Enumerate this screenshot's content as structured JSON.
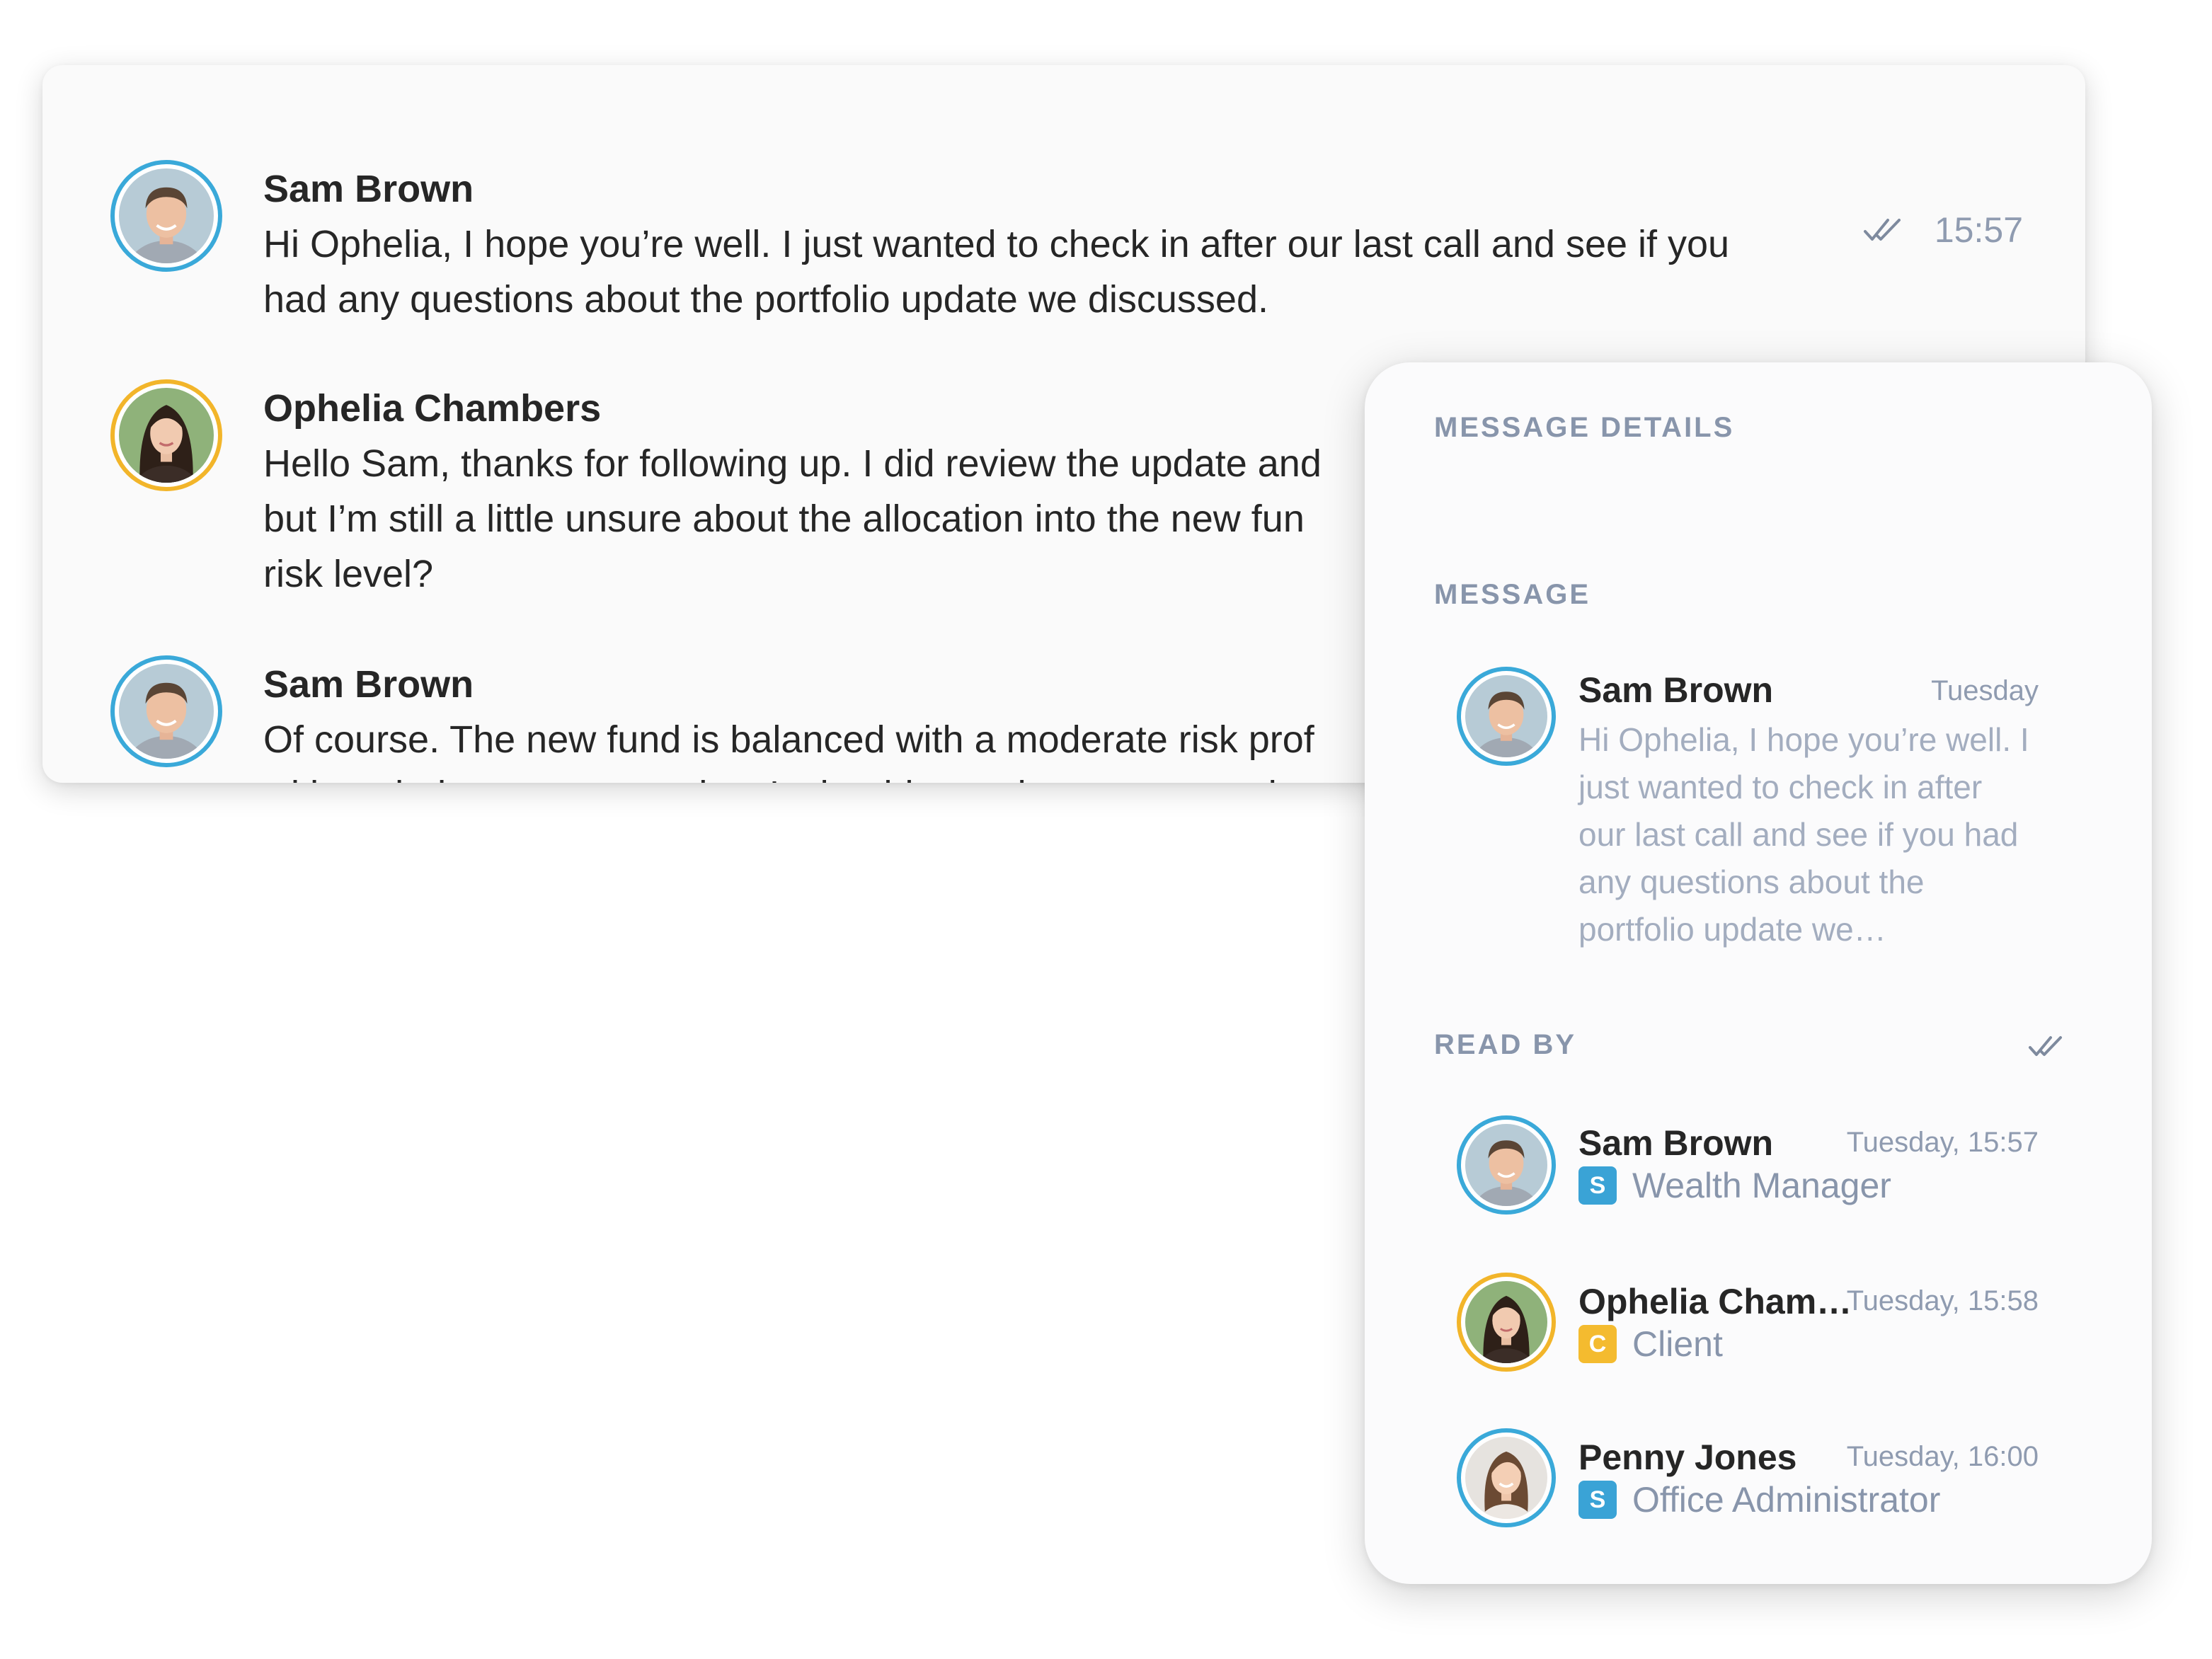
{
  "chat": {
    "messages": [
      {
        "sender": "Sam Brown",
        "lines": [
          "Hi Ophelia, I hope you’re well. I just wanted to check in after our last call and see if you",
          "had any questions about the portfolio update we discussed."
        ],
        "time": "15:57",
        "status_icon": "double-check-icon"
      },
      {
        "sender": "Ophelia Chambers",
        "lines": [
          "Hello Sam, thanks for following up. I did review the update and",
          "but I’m still a little unsure about the allocation into the new fun",
          "risk level?"
        ]
      },
      {
        "sender": "Sam Brown",
        "lines": [
          "Of course. The new fund is balanced with a moderate risk prof",
          "without being too aggressive. It should complement your exist"
        ]
      }
    ]
  },
  "details": {
    "title": "MESSAGE DETAILS",
    "message_label": "MESSAGE",
    "preview": {
      "sender": "Sam Brown",
      "date": "Tuesday",
      "lines": [
        "Hi Ophelia, I hope you’re well. I",
        "just wanted to check in after",
        "our last call and see if you had",
        "any questions about the",
        "portfolio update we…"
      ]
    },
    "read_by_label": "READ BY",
    "read_by_icon": "double-check-icon",
    "readers": [
      {
        "name": "Sam Brown",
        "time": "Tuesday, 15:57",
        "badge": "S",
        "role": "Wealth Manager",
        "badge_color": "#3aa3d6"
      },
      {
        "name": "Ophelia Cham…",
        "time": "Tuesday, 15:58",
        "badge": "C",
        "role": "Client",
        "badge_color": "#f4bb2f"
      },
      {
        "name": "Penny Jones",
        "time": "Tuesday, 16:00",
        "badge": "S",
        "role": "Office Administrator",
        "badge_color": "#3aa3d6"
      }
    ]
  },
  "colors": {
    "staff_ring": "#3aa9d9",
    "client_ring": "#f2b52a",
    "text_primary": "#262626",
    "text_muted": "#8f9bb0"
  }
}
